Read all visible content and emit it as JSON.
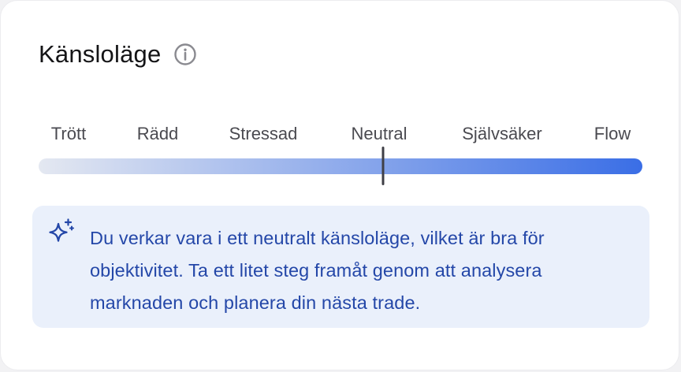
{
  "widget": {
    "title": "Känsloläge",
    "info_icon": "info-circle-icon"
  },
  "mood_scale": {
    "labels": [
      "Trött",
      "Rädd",
      "Stressad",
      "Neutral",
      "Självsäker",
      "Flow"
    ],
    "selected": "Neutral",
    "selected_index": 3,
    "value": 0.57,
    "gradient_start_color": "#e4e8f1",
    "gradient_end_color": "#3a6ee6",
    "thumb_color": "#3f3f46"
  },
  "insight": {
    "icon": "sparkle-icon",
    "text": "Du verkar vara i ett neutralt känsloläge, vilket är bra för objektivitet. Ta ett litet steg framåt genom att analysera marknaden och planera din nästa trade.",
    "background_color": "#eaf0fb",
    "text_color": "#2447a8"
  }
}
